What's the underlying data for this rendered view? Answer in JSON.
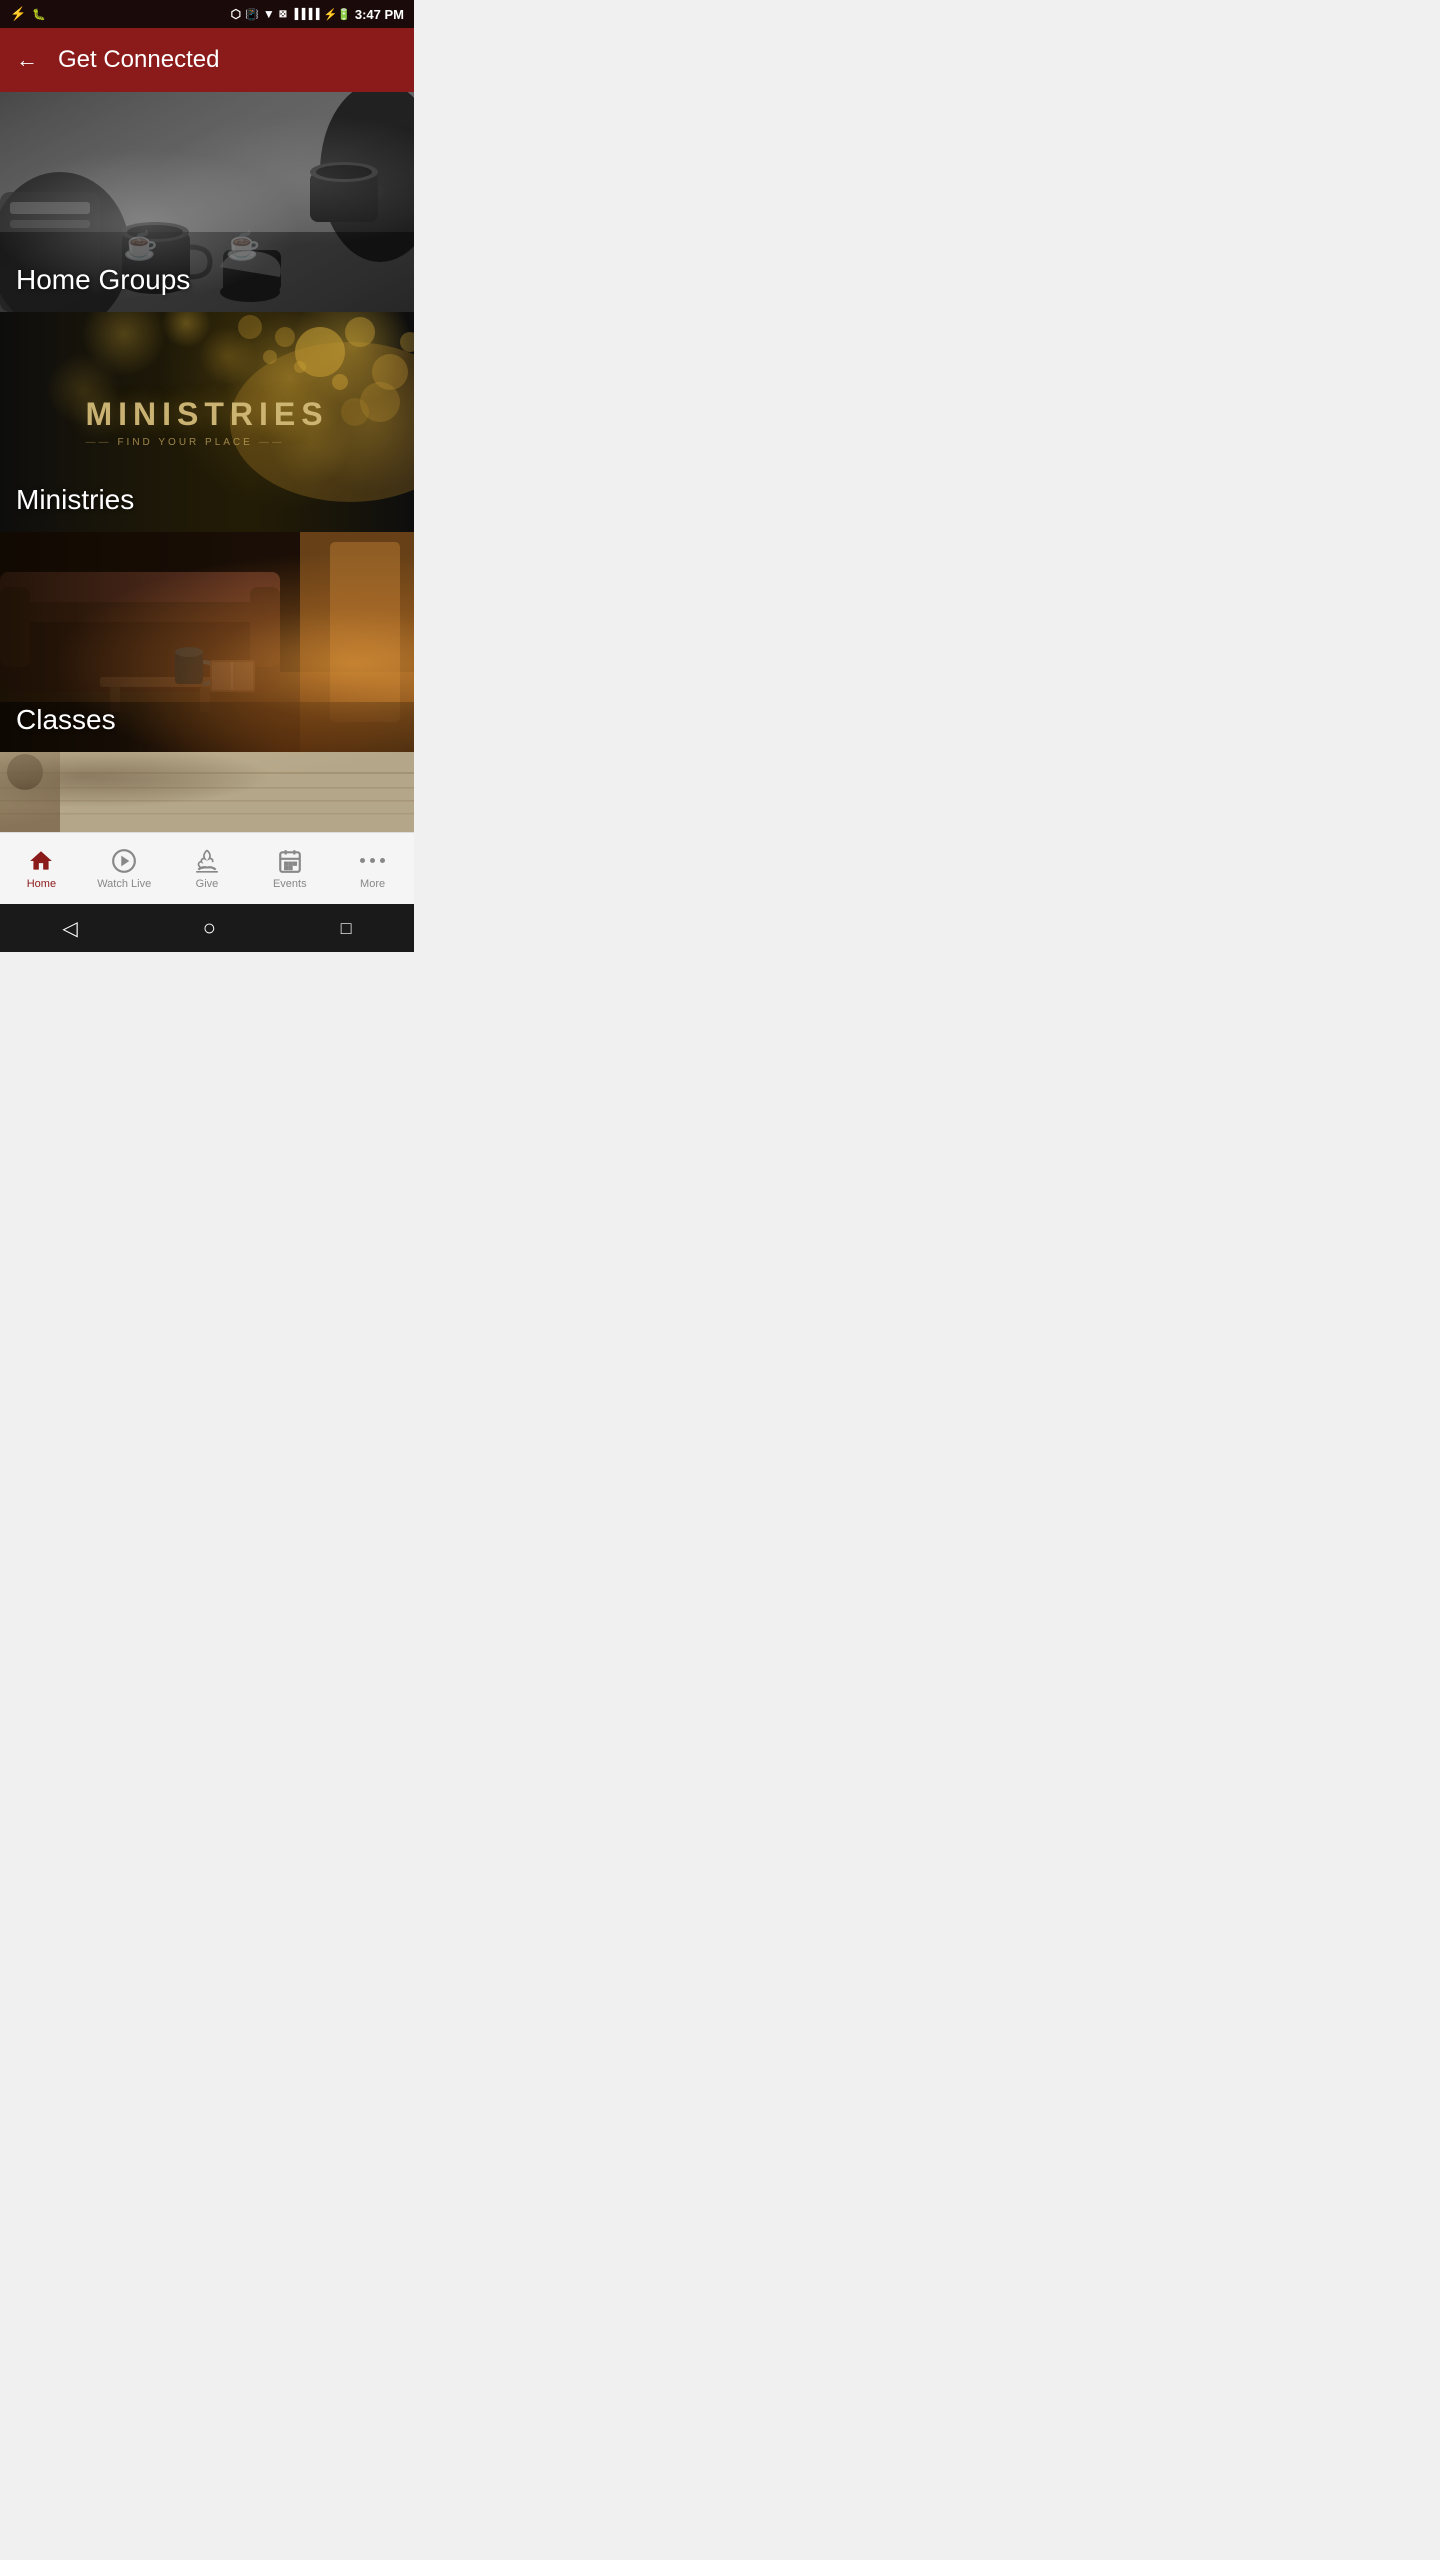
{
  "status_bar": {
    "time": "3:47 PM",
    "icons_left": [
      "usb",
      "bug"
    ],
    "icons_right": [
      "bluetooth",
      "vibrate",
      "wifi",
      "x-signal",
      "signal",
      "battery"
    ]
  },
  "header": {
    "title": "Get Connected",
    "back_label": "←"
  },
  "cards": [
    {
      "id": "home-groups",
      "label": "Home Groups",
      "type": "coffee-bw"
    },
    {
      "id": "ministries",
      "label": "Ministries",
      "overlay_title": "MINISTRIES",
      "overlay_subtitle": "FIND YOUR PLACE",
      "type": "dark-bokeh"
    },
    {
      "id": "classes",
      "label": "Classes",
      "type": "warm-room"
    },
    {
      "id": "partial",
      "label": "",
      "type": "paper"
    }
  ],
  "bottom_nav": {
    "items": [
      {
        "id": "home",
        "label": "Home",
        "active": true,
        "icon": "home"
      },
      {
        "id": "watch-live",
        "label": "Watch Live",
        "active": false,
        "icon": "play"
      },
      {
        "id": "give",
        "label": "Give",
        "active": false,
        "icon": "give"
      },
      {
        "id": "events",
        "label": "Events",
        "active": false,
        "icon": "calendar"
      },
      {
        "id": "more",
        "label": "More",
        "active": false,
        "icon": "dots"
      }
    ]
  },
  "system_nav": {
    "back": "◁",
    "home": "○",
    "recent": "□"
  }
}
